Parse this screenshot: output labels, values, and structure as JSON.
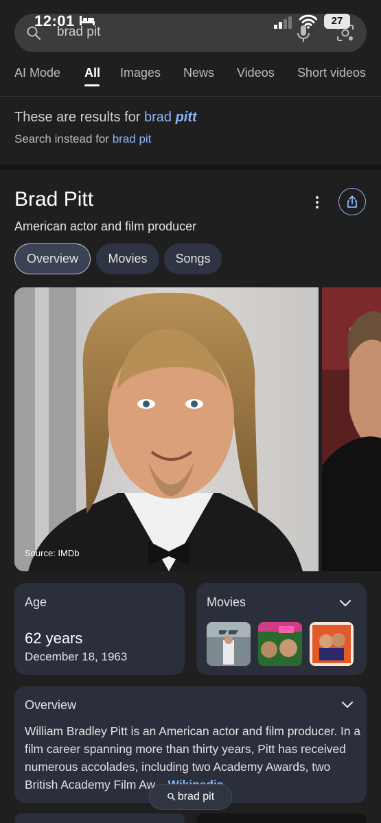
{
  "status": {
    "time": "12:01",
    "battery": "27"
  },
  "search": {
    "query": "brad pit"
  },
  "tabs": [
    {
      "label": "AI Mode"
    },
    {
      "label": "All"
    },
    {
      "label": "Images"
    },
    {
      "label": "News"
    },
    {
      "label": "Videos"
    },
    {
      "label": "Short videos"
    }
  ],
  "spelling": {
    "prefix": "These are results for",
    "corrected_plain": "brad",
    "corrected_emph": "pitt",
    "instead_prefix": "Search instead for",
    "original": "brad pit"
  },
  "panel": {
    "title": "Brad Pitt",
    "subtitle": "American actor and film producer",
    "chips": [
      {
        "label": "Overview"
      },
      {
        "label": "Movies"
      },
      {
        "label": "Songs"
      }
    ],
    "image_source": "Source: IMDb"
  },
  "age": {
    "label": "Age",
    "value": "62 years",
    "date": "December 18, 1963"
  },
  "movies": {
    "label": "Movies"
  },
  "overview": {
    "label": "Overview",
    "text": "William Bradley Pitt is an American actor and film producer. In a film career spanning more than thirty years, Pitt has received numerous accolades, including two Academy Awards, two British Academy Film Aw...",
    "link": "Wikipedia"
  },
  "float_search": {
    "label": "brad pit"
  },
  "colors": {
    "link": "#8ab4f8",
    "background": "#1f1f1f",
    "card": "#2a2f3b",
    "chip": "#2e3444"
  }
}
